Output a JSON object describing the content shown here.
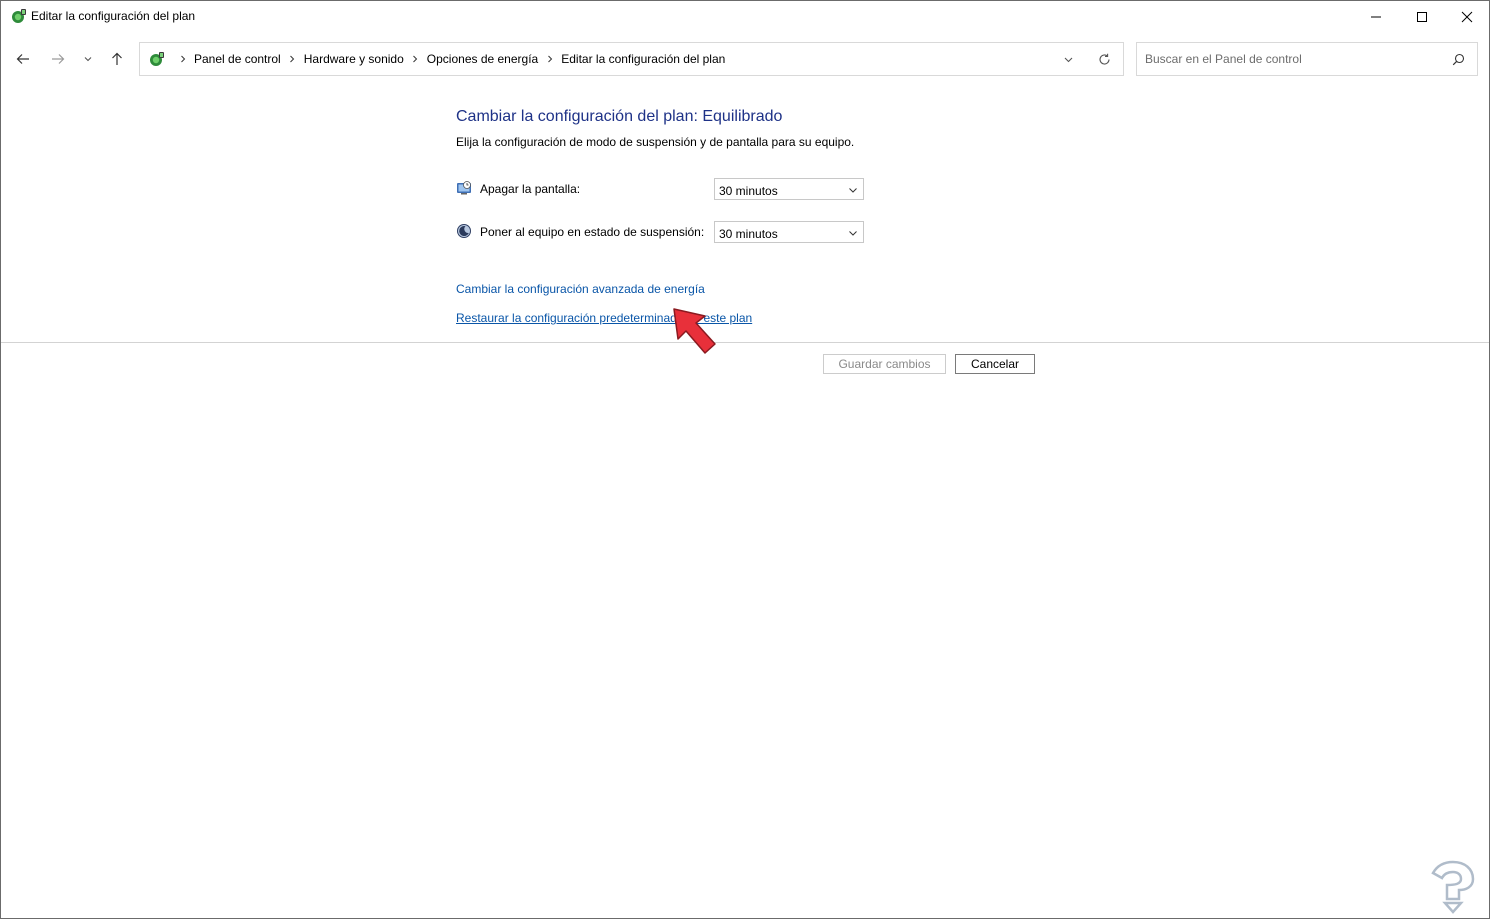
{
  "window": {
    "title": "Editar la configuración del plan"
  },
  "nav": {
    "breadcrumbs": [
      "Panel de control",
      "Hardware y sonido",
      "Opciones de energía",
      "Editar la configuración del plan"
    ]
  },
  "search": {
    "placeholder": "Buscar en el Panel de control"
  },
  "main": {
    "heading": "Cambiar la configuración del plan: Equilibrado",
    "subtext": "Elija la configuración de modo de suspensión y de pantalla para su equipo.",
    "settings": [
      {
        "label": "Apagar la pantalla:",
        "value": "30 minutos",
        "icon": "display-clock-icon"
      },
      {
        "label": "Poner al equipo en estado de suspensión:",
        "value": "30 minutos",
        "icon": "sleep-moon-icon"
      }
    ],
    "links": {
      "advanced": "Cambiar la configuración avanzada de energía",
      "restore": "Restaurar la configuración predeterminada de este plan"
    },
    "buttons": {
      "save": "Guardar cambios",
      "cancel": "Cancelar"
    }
  },
  "colors": {
    "heading": "#1e3287",
    "link": "#0a56a8",
    "pointer": "#e8303a"
  }
}
